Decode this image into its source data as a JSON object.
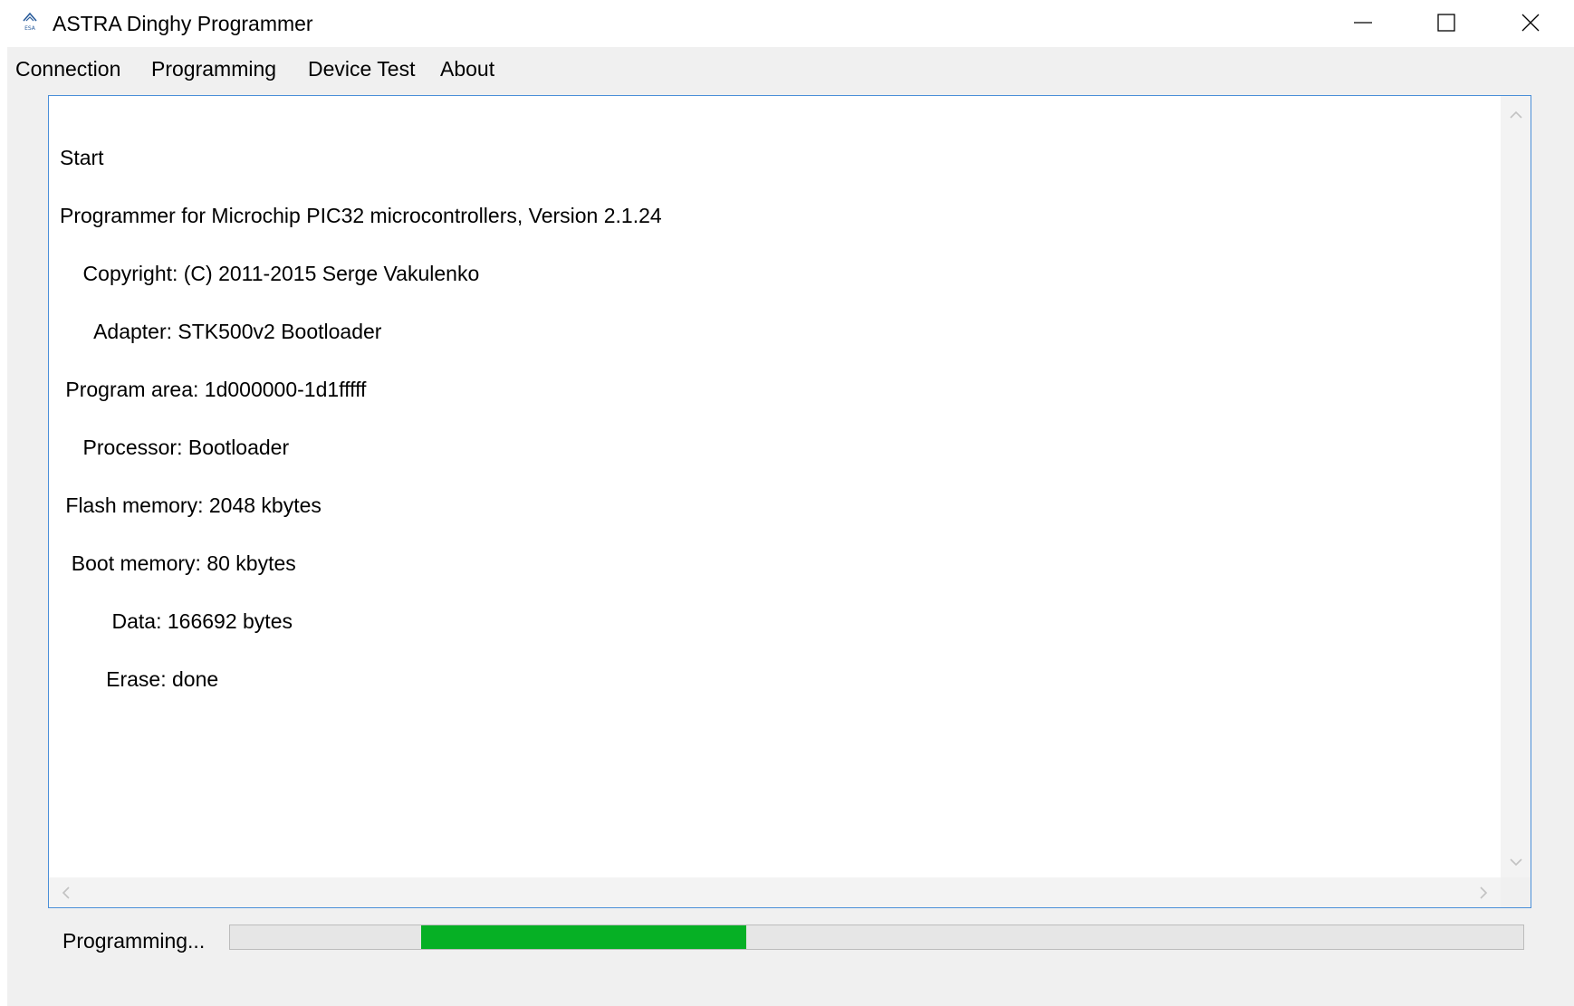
{
  "window": {
    "title": "ASTRA Dinghy Programmer",
    "icon": "astra-logo-icon",
    "controls": [
      "minimize-icon",
      "maximize-icon",
      "close-icon"
    ]
  },
  "menu": {
    "items": [
      "Connection",
      "Programming",
      "Device Test",
      "About"
    ]
  },
  "log": {
    "lines": [
      "Start",
      "Programmer for Microchip PIC32 microcontrollers, Version 2.1.24",
      "    Copyright: (C) 2011-2015 Serge Vakulenko",
      "      Adapter: STK500v2 Bootloader",
      " Program area: 1d000000-1d1fffff",
      "    Processor: Bootloader",
      " Flash memory: 2048 kbytes",
      "  Boot memory: 80 kbytes",
      "         Data: 166692 bytes",
      "        Erase: done"
    ]
  },
  "status": {
    "label": "Programming...",
    "progress": {
      "start_fraction": 0.148,
      "end_fraction": 0.399,
      "color": "#06b025"
    }
  },
  "colors": {
    "accent_border": "#4a8fd8",
    "progress_green": "#06b025"
  }
}
